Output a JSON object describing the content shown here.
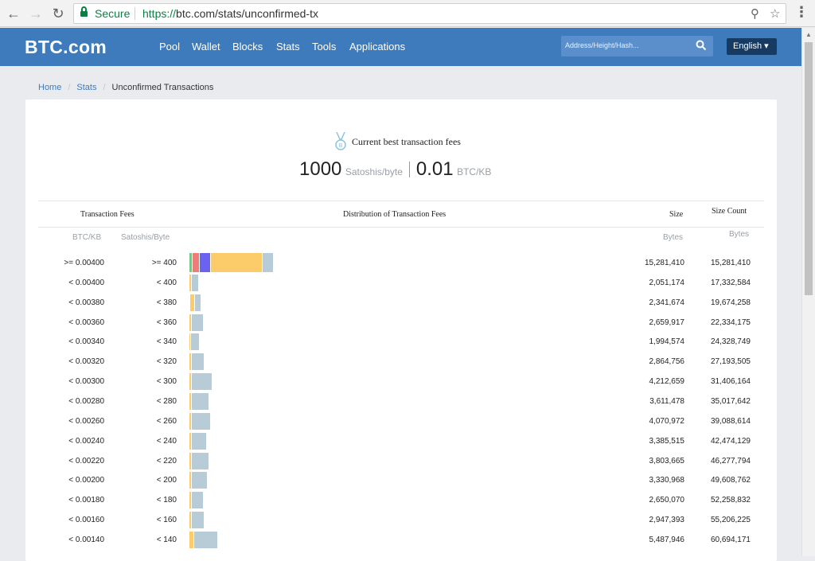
{
  "browser": {
    "secure_label": "Secure",
    "url_protocol": "https://",
    "url_rest": "btc.com/stats/unconfirmed-tx"
  },
  "site": {
    "logo": "BTC.com",
    "nav": [
      "Pool",
      "Wallet",
      "Blocks",
      "Stats",
      "Tools",
      "Applications"
    ],
    "search_placeholder": "Address/Height/Hash...",
    "language": "English ▾"
  },
  "breadcrumb": {
    "home": "Home",
    "stats": "Stats",
    "current": "Unconfirmed Transactions"
  },
  "fees": {
    "title": "Current best transaction fees",
    "sat_value": "1000",
    "sat_unit": "Satoshis/byte",
    "btc_value": "0.01",
    "btc_unit": "BTC/KB"
  },
  "table": {
    "headers": {
      "transaction_fees": "Transaction Fees",
      "distribution": "Distribution of Transaction Fees",
      "size": "Size",
      "size_count": "Size Count"
    },
    "subheaders": {
      "btc_kb": "BTC/KB",
      "sat_byte": "Satoshis/Byte",
      "size_bytes": "Bytes",
      "count_bytes": "Bytes"
    },
    "rows": [
      {
        "btc": ">= 0.00400",
        "sat": ">= 400",
        "size": "15,281,410",
        "count": "15,281,410"
      },
      {
        "btc": "< 0.00400",
        "sat": "< 400",
        "size": "2,051,174",
        "count": "17,332,584"
      },
      {
        "btc": "< 0.00380",
        "sat": "< 380",
        "size": "2,341,674",
        "count": "19,674,258"
      },
      {
        "btc": "< 0.00360",
        "sat": "< 360",
        "size": "2,659,917",
        "count": "22,334,175"
      },
      {
        "btc": "< 0.00340",
        "sat": "< 340",
        "size": "1,994,574",
        "count": "24,328,749"
      },
      {
        "btc": "< 0.00320",
        "sat": "< 320",
        "size": "2,864,756",
        "count": "27,193,505"
      },
      {
        "btc": "< 0.00300",
        "sat": "< 300",
        "size": "4,212,659",
        "count": "31,406,164"
      },
      {
        "btc": "< 0.00280",
        "sat": "< 280",
        "size": "3,611,478",
        "count": "35,017,642"
      },
      {
        "btc": "< 0.00260",
        "sat": "< 260",
        "size": "4,070,972",
        "count": "39,088,614"
      },
      {
        "btc": "< 0.00240",
        "sat": "< 240",
        "size": "3,385,515",
        "count": "42,474,129"
      },
      {
        "btc": "< 0.00220",
        "sat": "< 220",
        "size": "3,803,665",
        "count": "46,277,794"
      },
      {
        "btc": "< 0.00200",
        "sat": "< 200",
        "size": "3,330,968",
        "count": "49,608,762"
      },
      {
        "btc": "< 0.00180",
        "sat": "< 180",
        "size": "2,650,070",
        "count": "52,258,832"
      },
      {
        "btc": "< 0.00160",
        "sat": "< 160",
        "size": "2,947,393",
        "count": "55,206,225"
      },
      {
        "btc": "< 0.00140",
        "sat": "< 140",
        "size": "5,487,946",
        "count": "60,694,171"
      }
    ]
  },
  "colors": {
    "header_bg": "#3d7bbd",
    "lang_bg": "#173a63",
    "green": "#77c78c",
    "red": "#ef7b7b",
    "blue": "#6b63f0",
    "orange": "#fccb6a",
    "grey": "#b7ccd6"
  }
}
